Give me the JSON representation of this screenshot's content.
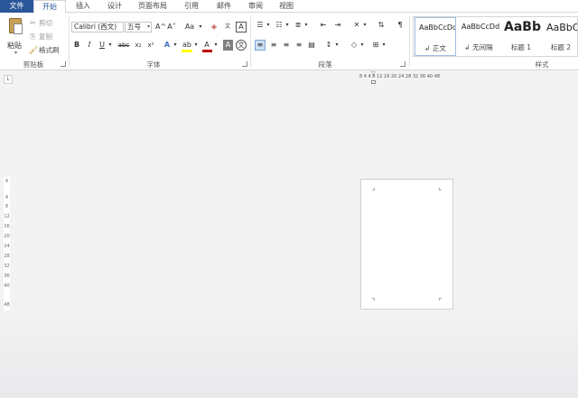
{
  "tabs": [
    {
      "label": "文件"
    },
    {
      "label": "开始"
    },
    {
      "label": "插入"
    },
    {
      "label": "设计"
    },
    {
      "label": "页面布局"
    },
    {
      "label": "引用"
    },
    {
      "label": "邮件"
    },
    {
      "label": "审阅"
    },
    {
      "label": "视图"
    }
  ],
  "active_tab": "开始",
  "colors": {
    "file_tab": "#2b579a",
    "highlight": "#ffff00",
    "font_color": "#c00000"
  },
  "clipboard": {
    "paste_label": "粘贴",
    "cut_label": "剪切",
    "copy_label": "复制",
    "format_painter_label": "格式刷",
    "group_label": "剪贴板"
  },
  "font": {
    "font_name": "Calibri (西文)",
    "font_size": "五号",
    "group_label": "字体",
    "buttons": [
      "A^",
      "A˅",
      "Aa",
      "B",
      "I",
      "U",
      "abc",
      "x₂",
      "x²",
      "A",
      "A",
      "A",
      "A",
      "文"
    ]
  },
  "paragraph": {
    "group_label": "段落"
  },
  "styles": {
    "group_label": "样式",
    "items": [
      {
        "sample": "AaBbCcDd",
        "name": "↲ 正文"
      },
      {
        "sample": "AaBbCcDd",
        "name": "↲ 无间隔"
      },
      {
        "sample": "AaBb",
        "name": "标题 1"
      },
      {
        "sample": "AaBbC",
        "name": "标题 2"
      }
    ]
  },
  "ruler": {
    "corner": "L",
    "horizontal": "8 4   4  8 12 16 20 24 28 32 36  40 48",
    "vertical": [
      "4",
      "4",
      "8",
      "12",
      "16",
      "20",
      "24",
      "28",
      "32",
      "36",
      "40",
      "48"
    ]
  }
}
